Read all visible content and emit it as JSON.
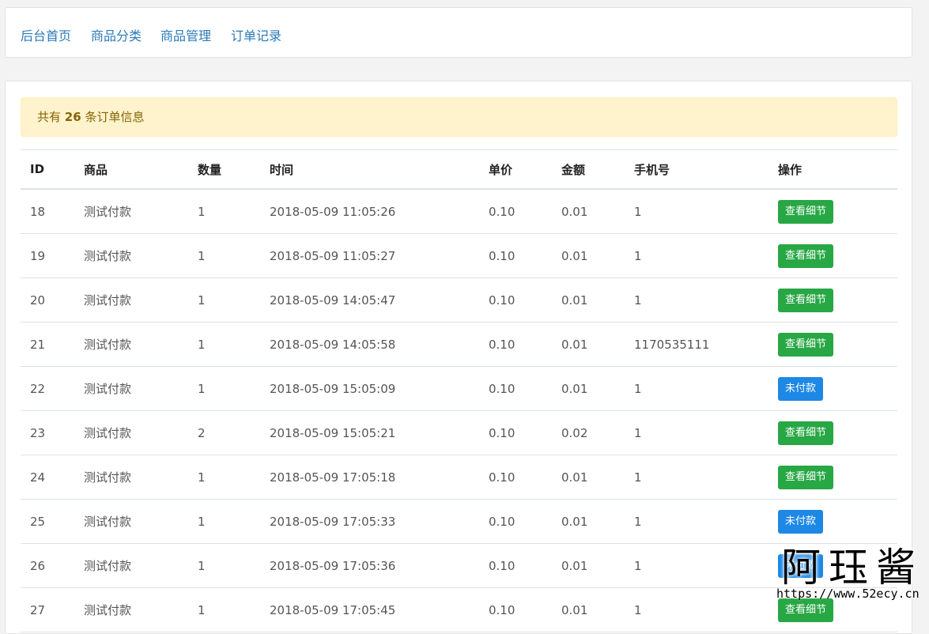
{
  "nav": {
    "items": [
      "后台首页",
      "商品分类",
      "商品管理",
      "订单记录"
    ]
  },
  "alert": {
    "prefix": "共有",
    "count": "26",
    "suffix": "条订单信息"
  },
  "table": {
    "headers": [
      "ID",
      "商品",
      "数量",
      "时间",
      "单价",
      "金额",
      "手机号",
      "操作"
    ],
    "rows": [
      {
        "id": "18",
        "product": "测试付款",
        "qty": "1",
        "time": "2018-05-09 11:05:26",
        "price": "0.10",
        "amount": "0.01",
        "phone": "1",
        "action": "查看细节",
        "status": "paid"
      },
      {
        "id": "19",
        "product": "测试付款",
        "qty": "1",
        "time": "2018-05-09 11:05:27",
        "price": "0.10",
        "amount": "0.01",
        "phone": "1",
        "action": "查看细节",
        "status": "paid"
      },
      {
        "id": "20",
        "product": "测试付款",
        "qty": "1",
        "time": "2018-05-09 14:05:47",
        "price": "0.10",
        "amount": "0.01",
        "phone": "1",
        "action": "查看细节",
        "status": "paid"
      },
      {
        "id": "21",
        "product": "测试付款",
        "qty": "1",
        "time": "2018-05-09 14:05:58",
        "price": "0.10",
        "amount": "0.01",
        "phone": "1170535111",
        "action": "查看细节",
        "status": "paid"
      },
      {
        "id": "22",
        "product": "测试付款",
        "qty": "1",
        "time": "2018-05-09 15:05:09",
        "price": "0.10",
        "amount": "0.01",
        "phone": "1",
        "action": "未付款",
        "status": "unpaid"
      },
      {
        "id": "23",
        "product": "测试付款",
        "qty": "2",
        "time": "2018-05-09 15:05:21",
        "price": "0.10",
        "amount": "0.02",
        "phone": "1",
        "action": "查看细节",
        "status": "paid"
      },
      {
        "id": "24",
        "product": "测试付款",
        "qty": "1",
        "time": "2018-05-09 17:05:18",
        "price": "0.10",
        "amount": "0.01",
        "phone": "1",
        "action": "查看细节",
        "status": "paid"
      },
      {
        "id": "25",
        "product": "测试付款",
        "qty": "1",
        "time": "2018-05-09 17:05:33",
        "price": "0.10",
        "amount": "0.01",
        "phone": "1",
        "action": "未付款",
        "status": "unpaid"
      },
      {
        "id": "26",
        "product": "测试付款",
        "qty": "1",
        "time": "2018-05-09 17:05:36",
        "price": "0.10",
        "amount": "0.01",
        "phone": "1",
        "action": "未付款",
        "status": "unpaid"
      },
      {
        "id": "27",
        "product": "测试付款",
        "qty": "1",
        "time": "2018-05-09 17:05:45",
        "price": "0.10",
        "amount": "0.01",
        "phone": "1",
        "action": "查看细节",
        "status": "paid"
      }
    ]
  },
  "watermark": {
    "text": "阿珏酱",
    "url": "https://www.52ecy.cn"
  },
  "colors": {
    "link": "#2a7ab8",
    "paid_button": "#28a745",
    "unpaid_button": "#1e88e5",
    "alert_bg": "#fff3cd"
  }
}
